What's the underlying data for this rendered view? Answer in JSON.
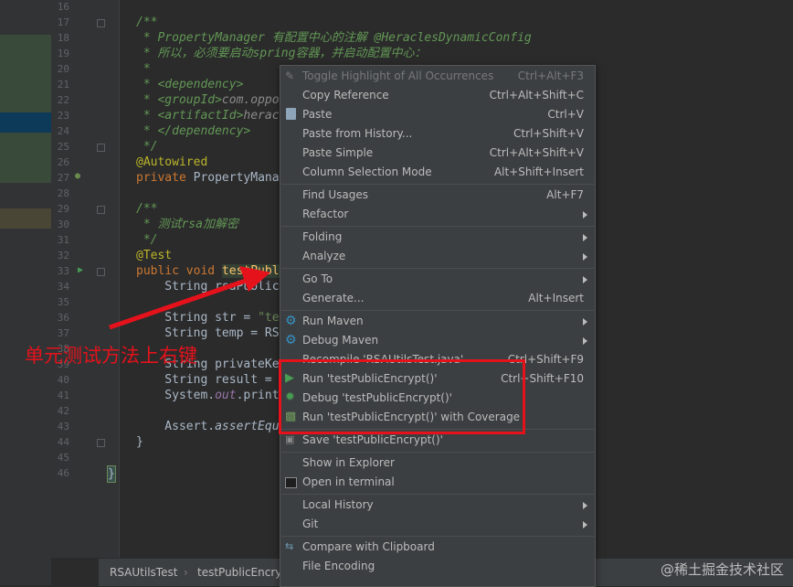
{
  "gutter": {
    "line_numbers": [
      "16",
      "17",
      "18",
      "19",
      "20",
      "21",
      "22",
      "23",
      "24",
      "25",
      "26",
      "27",
      "28",
      "29",
      "30",
      "31",
      "32",
      "33",
      "34",
      "35",
      "36",
      "37",
      "38",
      "39",
      "40",
      "41",
      "42",
      "43",
      "44",
      "45",
      "46"
    ]
  },
  "code": {
    "l17": "/**",
    "l18": " * PropertyManager 有配置中心的注解 @HeraclesDynamicConfig",
    "l19": " * 所以，必须要启动spring容器，并启动配置中心：",
    "l20": " *",
    "l21": " * <dependency>",
    "l22a": " * <groupId>",
    "l22b": "com.oppo",
    "l23a": " * <artifactId>",
    "l23b": "herac",
    "l24": " * </dependency>",
    "l25": " */",
    "l26": "@Autowired",
    "l27a": "private ",
    "l27b": "PropertyMana",
    "l29": "/**",
    "l30": " * 测试rsa加解密",
    "l31": " */",
    "l32": "@Test",
    "l33a": "public void ",
    "l33b": "testPubl",
    "l34": "    String rsaPublic",
    "l36a": "    String str = ",
    "l36b": "\"te",
    "l37": "    String temp = RS",
    "l39": "    String privateKe",
    "l40": "    String result = ",
    "l41a": "    System.",
    "l41b": "out",
    "l41c": ".print",
    "l43a": "    Assert.",
    "l43b": "assertEqu",
    "l44": "}",
    "l46": "}"
  },
  "menu": {
    "toggle_highlight": {
      "label": "Toggle Highlight of All Occurrences",
      "shortcut": "Ctrl+Alt+F3"
    },
    "copy_reference": {
      "label": "Copy Reference",
      "shortcut": "Ctrl+Alt+Shift+C"
    },
    "paste": {
      "label": "Paste",
      "shortcut": "Ctrl+V"
    },
    "paste_history": {
      "label": "Paste from History...",
      "shortcut": "Ctrl+Shift+V"
    },
    "paste_simple": {
      "label": "Paste Simple",
      "shortcut": "Ctrl+Alt+Shift+V"
    },
    "column_selection": {
      "label": "Column Selection Mode",
      "shortcut": "Alt+Shift+Insert"
    },
    "find_usages": {
      "label": "Find Usages",
      "shortcut": "Alt+F7"
    },
    "refactor": {
      "label": "Refactor"
    },
    "folding": {
      "label": "Folding"
    },
    "analyze": {
      "label": "Analyze"
    },
    "go_to": {
      "label": "Go To"
    },
    "generate": {
      "label": "Generate...",
      "shortcut": "Alt+Insert"
    },
    "run_maven": {
      "label": "Run Maven"
    },
    "debug_maven": {
      "label": "Debug Maven"
    },
    "recompile": {
      "label": "Recompile 'RSAUtilsTest.java'",
      "shortcut": "Ctrl+Shift+F9"
    },
    "run": {
      "label": "Run 'testPublicEncrypt()'",
      "shortcut": "Ctrl+Shift+F10"
    },
    "debug": {
      "label": "Debug 'testPublicEncrypt()'"
    },
    "run_coverage": {
      "label": "Run 'testPublicEncrypt()' with Coverage"
    },
    "save": {
      "label": "Save 'testPublicEncrypt()'"
    },
    "show_explorer": {
      "label": "Show in Explorer"
    },
    "open_terminal": {
      "label": "Open in terminal"
    },
    "local_history": {
      "label": "Local History"
    },
    "git": {
      "label": "Git"
    },
    "compare_clipboard": {
      "label": "Compare with Clipboard"
    },
    "file_encoding": {
      "label": "File Encoding"
    }
  },
  "breadcrumb": {
    "file": "RSAUtilsTest",
    "sep": "›",
    "method": "testPublicEncryp"
  },
  "annotation": {
    "label": "单元测试方法上右键"
  },
  "watermark": "@稀土掘金技术社区",
  "colors": {
    "accent_red": "#e5121b",
    "run_green": "#499c54",
    "maven_blue": "#3592c4"
  }
}
